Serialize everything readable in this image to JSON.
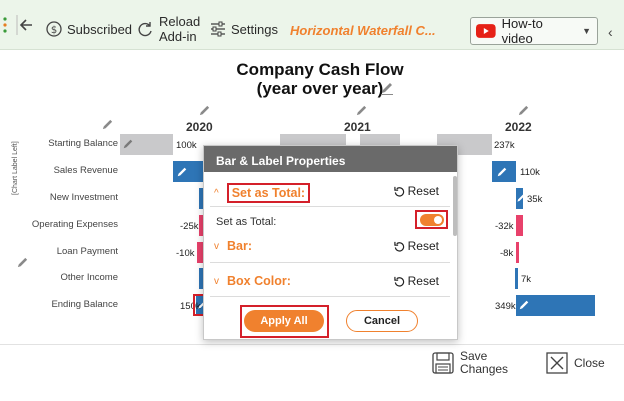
{
  "toolbar": {
    "subscribed_label": "Subscribed",
    "reload_line1": "Reload",
    "reload_line2": "Add-in",
    "settings_label": "Settings",
    "addin_title": "Horizontal Waterfall C...",
    "howto_label": "How-to video",
    "collapse_glyph": "‹"
  },
  "chart": {
    "title_line1": "Company Cash Flow",
    "title_line2": "(year over year)",
    "years": [
      "2020",
      "2021",
      "2022"
    ],
    "categories": [
      "Starting Balance",
      "Sales Revenue",
      "New Investment",
      "Operating Expenses",
      "Loan Payment",
      "Other Income",
      "Ending Balance"
    ],
    "axis_label": "[Chart Label Left]",
    "value_labels_2020": [
      "100k",
      "-25k",
      "-10k",
      "150k"
    ],
    "value_labels_2022": [
      "237k",
      "110k",
      "35k",
      "-32k",
      "-8k",
      "7k",
      "349k"
    ],
    "colors": {
      "total": "#c9c9cb",
      "increase": "#2e75b6",
      "decrease": "#e8416b",
      "accent": "#f0812e"
    }
  },
  "chart_data": {
    "type": "bar",
    "title": "Company Cash Flow (year over year)",
    "ylabel": "[Chart Label Left]",
    "categories": [
      "Starting Balance",
      "Sales Revenue",
      "New Investment",
      "Operating Expenses",
      "Loan Payment",
      "Other Income",
      "Ending Balance"
    ],
    "series": [
      {
        "name": "2020",
        "values": [
          100,
          null,
          null,
          -25,
          -10,
          null,
          150
        ]
      },
      {
        "name": "2022",
        "values": [
          237,
          110,
          35,
          -32,
          -8,
          7,
          349
        ]
      }
    ]
  },
  "dialog": {
    "title": "Bar & Label Properties",
    "section_total": "Set as Total:",
    "set_total_row_label": "Set as Total:",
    "section_bar": "Bar:",
    "section_box_color": "Box Color:",
    "reset_label": "Reset",
    "apply_label": "Apply All",
    "cancel_label": "Cancel",
    "toggle_on": true
  },
  "footer": {
    "save_line1": "Save",
    "save_line2": "Changes",
    "close_label": "Close"
  }
}
